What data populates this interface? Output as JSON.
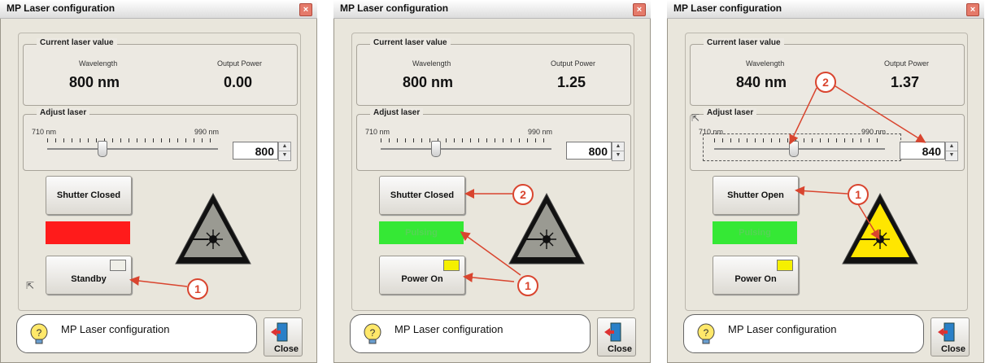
{
  "panels": [
    {
      "title": "MP Laser configuration",
      "current": {
        "label": "Current laser value",
        "wavelength_head": "Wavelength",
        "power_head": "Output Power",
        "wavelength": "800 nm",
        "power": "0.00"
      },
      "adjust": {
        "label": "Adjust laser",
        "min": "710 nm",
        "max": "990 nm",
        "value": "800",
        "slider_fraction": 0.32
      },
      "shutter": "Shutter Closed",
      "status_text": "",
      "status_color": "#ff1b1b",
      "power_button": "Standby",
      "power_light": "#efefe8",
      "laser_active": false,
      "message": "MP Laser configuration",
      "close": "Close"
    },
    {
      "title": "MP Laser configuration",
      "current": {
        "label": "Current laser value",
        "wavelength_head": "Wavelength",
        "power_head": "Output Power",
        "wavelength": "800 nm",
        "power": "1.25"
      },
      "adjust": {
        "label": "Adjust laser",
        "min": "710 nm",
        "max": "990 nm",
        "value": "800",
        "slider_fraction": 0.32
      },
      "shutter": "Shutter Closed",
      "status_text": "Pulsing",
      "status_color": "#35e835",
      "power_button": "Power On",
      "power_light": "#f5f000",
      "laser_active": false,
      "message": "MP Laser configuration",
      "close": "Close"
    },
    {
      "title": "MP Laser configuration",
      "current": {
        "label": "Current laser value",
        "wavelength_head": "Wavelength",
        "power_head": "Output Power",
        "wavelength": "840 nm",
        "power": "1.37"
      },
      "adjust": {
        "label": "Adjust laser",
        "min": "710 nm",
        "max": "990 nm",
        "value": "840",
        "slider_fraction": 0.46
      },
      "shutter": "Shutter Open",
      "status_text": "Pulsing",
      "status_color": "#35e835",
      "power_button": "Power On",
      "power_light": "#f5f000",
      "laser_active": true,
      "message": "MP Laser configuration",
      "close": "Close"
    }
  ],
  "callouts": {
    "one": "1",
    "two": "2"
  },
  "colors": {
    "callout": "#d9452f",
    "warning_active": "#ffe600",
    "warning_inactive": "#9a9a92"
  }
}
